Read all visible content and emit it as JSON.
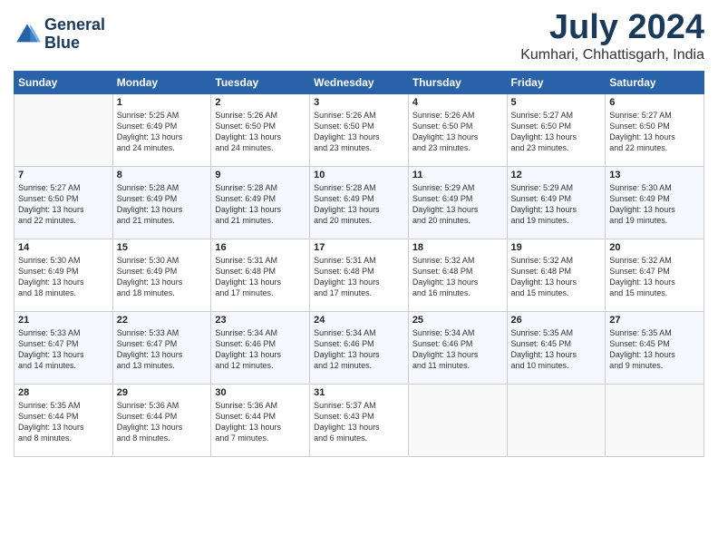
{
  "header": {
    "logo_line1": "General",
    "logo_line2": "Blue",
    "month": "July 2024",
    "location": "Kumhari, Chhattisgarh, India"
  },
  "days_of_week": [
    "Sunday",
    "Monday",
    "Tuesday",
    "Wednesday",
    "Thursday",
    "Friday",
    "Saturday"
  ],
  "weeks": [
    [
      {
        "day": "",
        "text": ""
      },
      {
        "day": "1",
        "text": "Sunrise: 5:25 AM\nSunset: 6:49 PM\nDaylight: 13 hours\nand 24 minutes."
      },
      {
        "day": "2",
        "text": "Sunrise: 5:26 AM\nSunset: 6:50 PM\nDaylight: 13 hours\nand 24 minutes."
      },
      {
        "day": "3",
        "text": "Sunrise: 5:26 AM\nSunset: 6:50 PM\nDaylight: 13 hours\nand 23 minutes."
      },
      {
        "day": "4",
        "text": "Sunrise: 5:26 AM\nSunset: 6:50 PM\nDaylight: 13 hours\nand 23 minutes."
      },
      {
        "day": "5",
        "text": "Sunrise: 5:27 AM\nSunset: 6:50 PM\nDaylight: 13 hours\nand 23 minutes."
      },
      {
        "day": "6",
        "text": "Sunrise: 5:27 AM\nSunset: 6:50 PM\nDaylight: 13 hours\nand 22 minutes."
      }
    ],
    [
      {
        "day": "7",
        "text": "Sunrise: 5:27 AM\nSunset: 6:50 PM\nDaylight: 13 hours\nand 22 minutes."
      },
      {
        "day": "8",
        "text": "Sunrise: 5:28 AM\nSunset: 6:49 PM\nDaylight: 13 hours\nand 21 minutes."
      },
      {
        "day": "9",
        "text": "Sunrise: 5:28 AM\nSunset: 6:49 PM\nDaylight: 13 hours\nand 21 minutes."
      },
      {
        "day": "10",
        "text": "Sunrise: 5:28 AM\nSunset: 6:49 PM\nDaylight: 13 hours\nand 20 minutes."
      },
      {
        "day": "11",
        "text": "Sunrise: 5:29 AM\nSunset: 6:49 PM\nDaylight: 13 hours\nand 20 minutes."
      },
      {
        "day": "12",
        "text": "Sunrise: 5:29 AM\nSunset: 6:49 PM\nDaylight: 13 hours\nand 19 minutes."
      },
      {
        "day": "13",
        "text": "Sunrise: 5:30 AM\nSunset: 6:49 PM\nDaylight: 13 hours\nand 19 minutes."
      }
    ],
    [
      {
        "day": "14",
        "text": "Sunrise: 5:30 AM\nSunset: 6:49 PM\nDaylight: 13 hours\nand 18 minutes."
      },
      {
        "day": "15",
        "text": "Sunrise: 5:30 AM\nSunset: 6:49 PM\nDaylight: 13 hours\nand 18 minutes."
      },
      {
        "day": "16",
        "text": "Sunrise: 5:31 AM\nSunset: 6:48 PM\nDaylight: 13 hours\nand 17 minutes."
      },
      {
        "day": "17",
        "text": "Sunrise: 5:31 AM\nSunset: 6:48 PM\nDaylight: 13 hours\nand 17 minutes."
      },
      {
        "day": "18",
        "text": "Sunrise: 5:32 AM\nSunset: 6:48 PM\nDaylight: 13 hours\nand 16 minutes."
      },
      {
        "day": "19",
        "text": "Sunrise: 5:32 AM\nSunset: 6:48 PM\nDaylight: 13 hours\nand 15 minutes."
      },
      {
        "day": "20",
        "text": "Sunrise: 5:32 AM\nSunset: 6:47 PM\nDaylight: 13 hours\nand 15 minutes."
      }
    ],
    [
      {
        "day": "21",
        "text": "Sunrise: 5:33 AM\nSunset: 6:47 PM\nDaylight: 13 hours\nand 14 minutes."
      },
      {
        "day": "22",
        "text": "Sunrise: 5:33 AM\nSunset: 6:47 PM\nDaylight: 13 hours\nand 13 minutes."
      },
      {
        "day": "23",
        "text": "Sunrise: 5:34 AM\nSunset: 6:46 PM\nDaylight: 13 hours\nand 12 minutes."
      },
      {
        "day": "24",
        "text": "Sunrise: 5:34 AM\nSunset: 6:46 PM\nDaylight: 13 hours\nand 12 minutes."
      },
      {
        "day": "25",
        "text": "Sunrise: 5:34 AM\nSunset: 6:46 PM\nDaylight: 13 hours\nand 11 minutes."
      },
      {
        "day": "26",
        "text": "Sunrise: 5:35 AM\nSunset: 6:45 PM\nDaylight: 13 hours\nand 10 minutes."
      },
      {
        "day": "27",
        "text": "Sunrise: 5:35 AM\nSunset: 6:45 PM\nDaylight: 13 hours\nand 9 minutes."
      }
    ],
    [
      {
        "day": "28",
        "text": "Sunrise: 5:35 AM\nSunset: 6:44 PM\nDaylight: 13 hours\nand 8 minutes."
      },
      {
        "day": "29",
        "text": "Sunrise: 5:36 AM\nSunset: 6:44 PM\nDaylight: 13 hours\nand 8 minutes."
      },
      {
        "day": "30",
        "text": "Sunrise: 5:36 AM\nSunset: 6:44 PM\nDaylight: 13 hours\nand 7 minutes."
      },
      {
        "day": "31",
        "text": "Sunrise: 5:37 AM\nSunset: 6:43 PM\nDaylight: 13 hours\nand 6 minutes."
      },
      {
        "day": "",
        "text": ""
      },
      {
        "day": "",
        "text": ""
      },
      {
        "day": "",
        "text": ""
      }
    ]
  ]
}
